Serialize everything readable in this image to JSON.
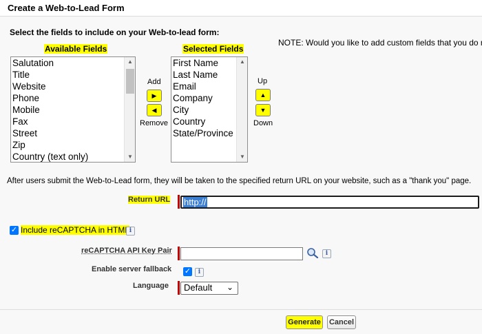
{
  "form": {
    "title": "Create a Web-to-Lead Form",
    "instruction": "Select the fields to include on your Web-to-lead form:",
    "note": "NOTE: Would you like to add custom fields that you do not"
  },
  "available": {
    "header": "Available Fields",
    "items": [
      "Salutation",
      "Title",
      "Website",
      "Phone",
      "Mobile",
      "Fax",
      "Street",
      "Zip",
      "Country (text only)"
    ]
  },
  "selected": {
    "header": "Selected Fields",
    "items": [
      "First Name",
      "Last Name",
      "Email",
      "Company",
      "City",
      "Country",
      "State/Province"
    ]
  },
  "transfer": {
    "add_label": "Add",
    "remove_label": "Remove",
    "up_label": "Up",
    "down_label": "Down"
  },
  "return_section": {
    "paragraph": "After users submit the Web-to-Lead form, they will be taken to the specified return URL on your website, such as a \"thank you\" page.",
    "return_url_label": "Return URL",
    "return_url_value": "http://"
  },
  "recaptcha": {
    "include_label": "Include reCAPTCHA in HTML",
    "include_checked": true,
    "api_key_label": "reCAPTCHA API Key Pair",
    "api_key_value": "",
    "fallback_label": "Enable server fallback",
    "fallback_checked": true,
    "language_label": "Language",
    "language_value": "Default"
  },
  "buttons": {
    "generate": "Generate",
    "cancel": "Cancel"
  },
  "icons": {
    "add": "arrow-right-icon",
    "remove": "arrow-left-icon",
    "up": "arrow-up-icon",
    "down": "arrow-down-icon",
    "info": "info-icon",
    "lookup": "lookup-icon"
  },
  "colors": {
    "highlight": "#ffff00",
    "required": "#c00000",
    "checkbox": "#0075ff",
    "selection": "#3b7fd4"
  }
}
